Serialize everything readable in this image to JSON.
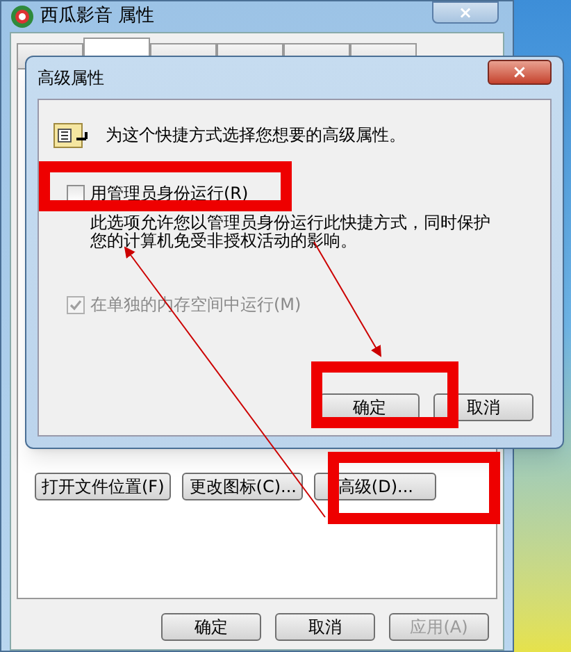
{
  "window": {
    "title": "西瓜影音 属性",
    "close": "×"
  },
  "tabs": [
    {
      "selected": false
    },
    {
      "selected": true
    },
    {
      "selected": false
    },
    {
      "selected": false
    },
    {
      "selected": false
    },
    {
      "selected": false
    }
  ],
  "shortcut_buttons": [
    {
      "label": "打开文件位置(F)"
    },
    {
      "label": "更改图标(C)..."
    },
    {
      "label": "高级(D)..."
    }
  ],
  "footer_buttons": [
    {
      "label": "确定",
      "disabled": false
    },
    {
      "label": "取消",
      "disabled": false
    },
    {
      "label": "应用(A)",
      "disabled": true
    }
  ],
  "dialog": {
    "title": "高级属性",
    "close": "×",
    "prompt": "为这个快捷方式选择您想要的高级属性。",
    "options": [
      {
        "label": "用管理员身份运行(R)",
        "checked": false,
        "disabled": false,
        "description": "此选项允许您以管理员身份运行此快捷方式，同时保护您的计算机免受非授权活动的影响。"
      },
      {
        "label": "在单独的内存空间中运行(M)",
        "checked": true,
        "disabled": true
      }
    ],
    "buttons": [
      {
        "label": "确定"
      },
      {
        "label": "取消"
      }
    ]
  }
}
